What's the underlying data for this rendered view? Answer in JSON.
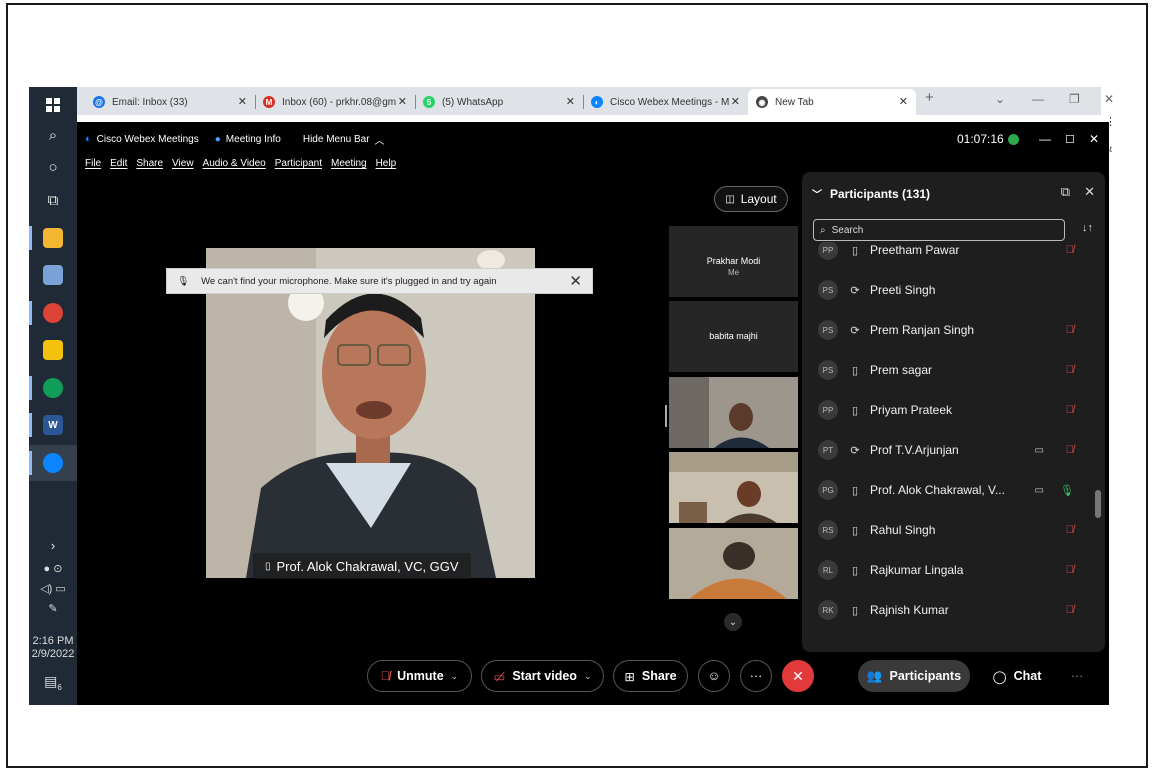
{
  "browser": {
    "tabs": [
      {
        "label": "Email: Inbox (33)",
        "icon": "mail-icon",
        "color": "#1a73e8"
      },
      {
        "label": "Inbox (60) - prkhr.08@gm",
        "icon": "gmail-icon",
        "color": "#d93025"
      },
      {
        "label": "(5) WhatsApp",
        "icon": "whatsapp-icon",
        "color": "#25d366"
      },
      {
        "label": "Cisco Webex Meetings - M",
        "icon": "webex-icon",
        "color": "#0a84ff"
      },
      {
        "label": "New Tab",
        "icon": "chrome-icon",
        "color": "#444444"
      }
    ],
    "close_glyph": "✕",
    "new_tab_glyph": "+",
    "side_text": "ist"
  },
  "taskbar": {
    "time": "2:16 PM",
    "date": "2/9/2022",
    "notification_count": "6"
  },
  "webex": {
    "app_title": "Cisco Webex Meetings",
    "meeting_info": "Meeting Info",
    "hide_menu_bar": "Hide Menu Bar",
    "timer": "01:07:16",
    "menu": [
      "File",
      "Edit",
      "Share",
      "View",
      "Audio & Video",
      "Participant",
      "Meeting",
      "Help"
    ],
    "layout_label": "Layout",
    "toast_message": "We can't find your microphone. Make sure it's plugged in and try again",
    "active_speaker": "Prof. Alok Chakrawal, VC, GGV",
    "thumbnails": [
      {
        "name": "Prakhar Modi",
        "sub": "Me"
      },
      {
        "name": "babita majhi",
        "sub": ""
      }
    ],
    "controls": {
      "unmute": "Unmute",
      "start_video": "Start video",
      "share": "Share",
      "participants": "Participants",
      "chat": "Chat",
      "more": "···"
    }
  },
  "participants_panel": {
    "title": "Participants (131)",
    "search_placeholder": "Search",
    "items": [
      {
        "initials": "PP",
        "name": "Preetham Pawar",
        "device": "phone",
        "camera": false,
        "mic": "muted"
      },
      {
        "initials": "PS",
        "name": "Preeti Singh",
        "device": "sync",
        "camera": false,
        "mic": "none"
      },
      {
        "initials": "PS",
        "name": "Prem Ranjan Singh",
        "device": "sync",
        "camera": false,
        "mic": "muted"
      },
      {
        "initials": "PS",
        "name": "Prem sagar",
        "device": "phone",
        "camera": false,
        "mic": "muted"
      },
      {
        "initials": "PP",
        "name": "Priyam Prateek",
        "device": "phone",
        "camera": false,
        "mic": "muted"
      },
      {
        "initials": "PT",
        "name": "Prof T.V.Arjunjan",
        "device": "sync",
        "camera": true,
        "mic": "muted"
      },
      {
        "initials": "PG",
        "name": "Prof. Alok Chakrawal, V...",
        "device": "phone",
        "camera": true,
        "mic": "on"
      },
      {
        "initials": "RS",
        "name": "Rahul Singh",
        "device": "phone",
        "camera": false,
        "mic": "muted"
      },
      {
        "initials": "RL",
        "name": "Rajkumar Lingala",
        "device": "phone",
        "camera": false,
        "mic": "muted"
      },
      {
        "initials": "RK",
        "name": "Rajnish Kumar",
        "device": "phone",
        "camera": false,
        "mic": "muted"
      }
    ]
  }
}
